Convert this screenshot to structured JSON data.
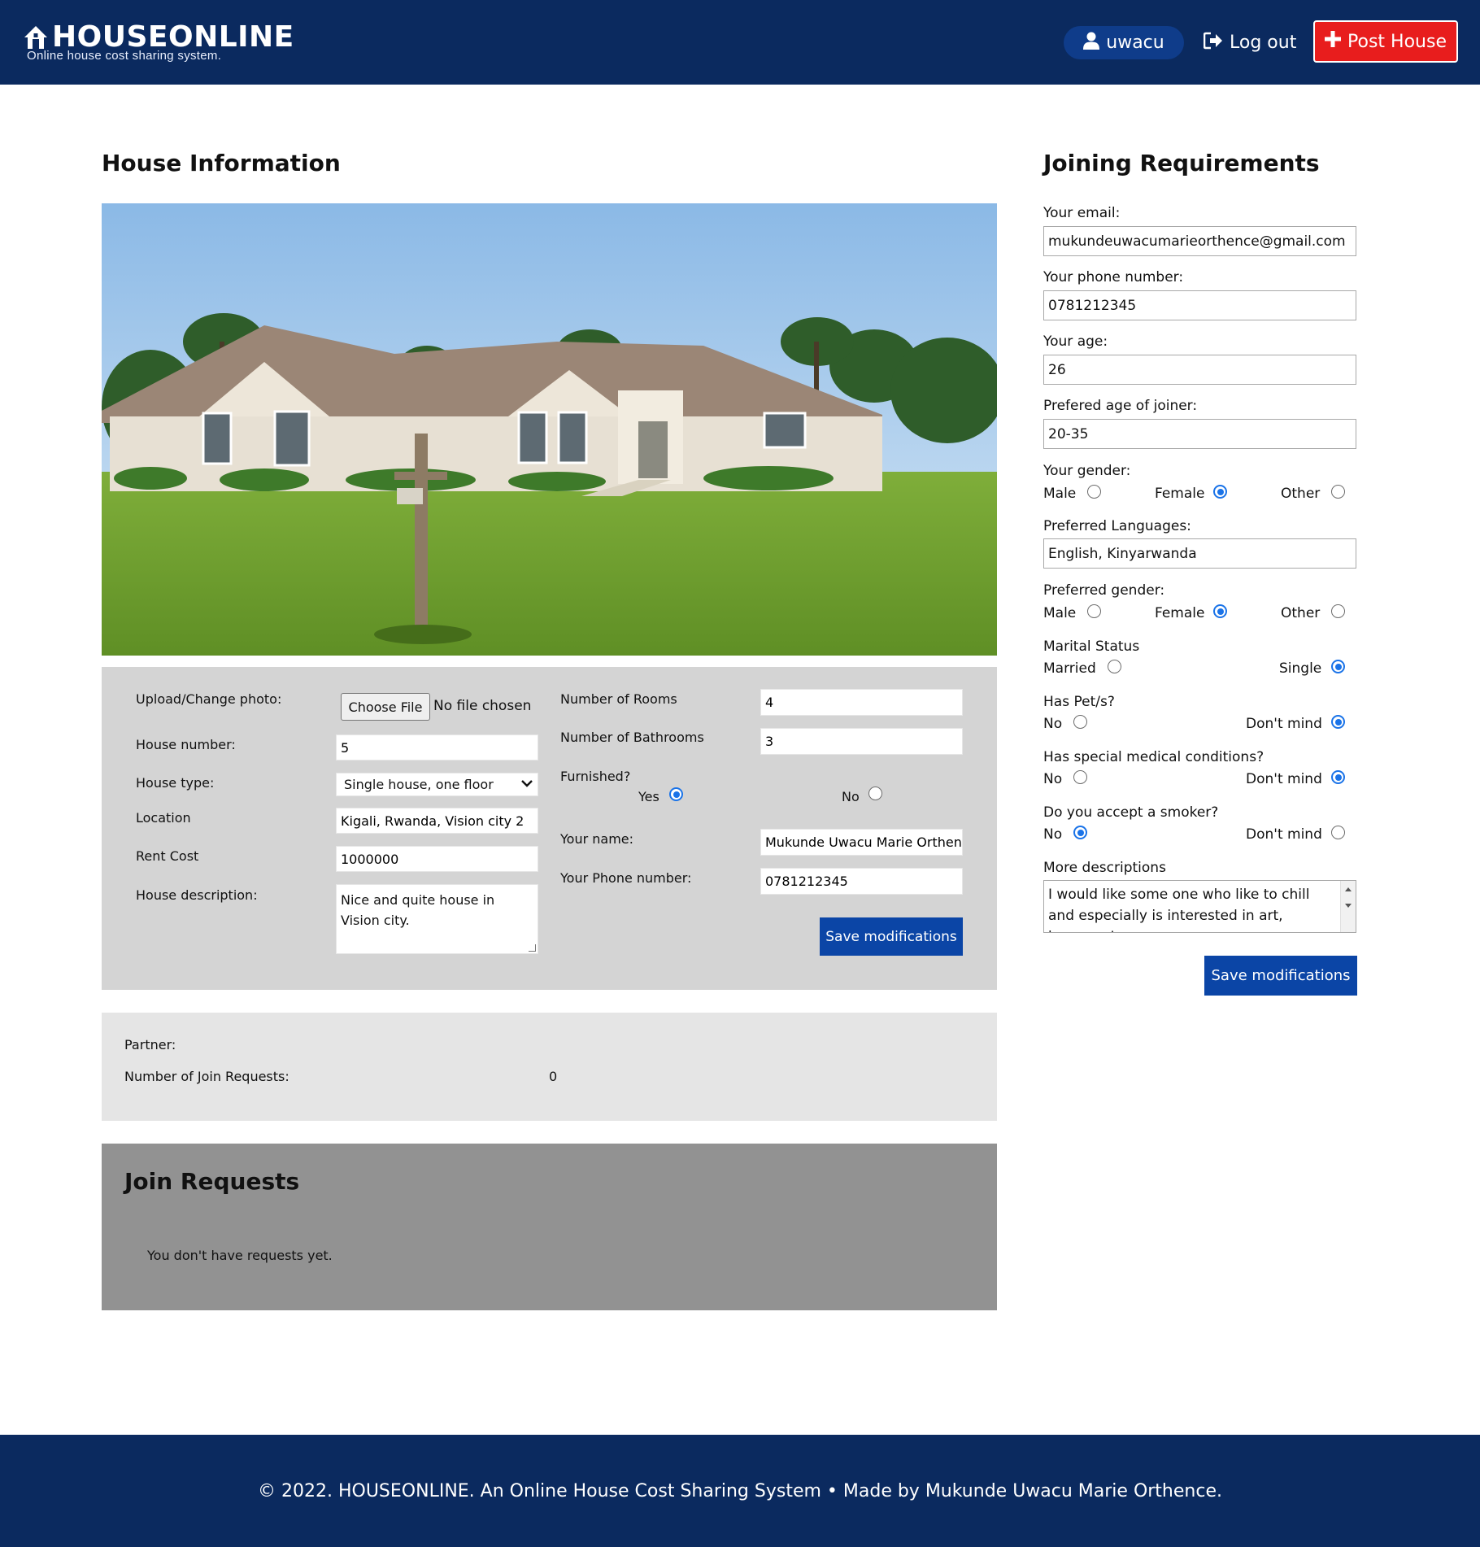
{
  "header": {
    "brand": "HOUSEONLINE",
    "tagline": "Online house cost sharing system.",
    "username": "uwacu",
    "logout_label": "Log out",
    "post_label": "Post House"
  },
  "house_section": {
    "title": "House Information",
    "photo_icon": "house-photo",
    "upload_label": "Upload/Change photo:",
    "choose_file_label": "Choose File",
    "file_status": "No file chosen",
    "house_number_label": "House number:",
    "house_number": "5",
    "house_type_label": "House type:",
    "house_type": "Single house, one floor",
    "location_label": "Location",
    "location": "Kigali, Rwanda, Vision city 2",
    "rent_label": "Rent Cost",
    "rent": "1000000",
    "description_label": "House description:",
    "description": "Nice and quite house in Vision city.",
    "rooms_label": "Number of Rooms",
    "rooms": "4",
    "bathrooms_label": "Number of Bathrooms",
    "bathrooms": "3",
    "furnished_label": "Furnished?",
    "furnished_yes": "Yes",
    "furnished_no": "No",
    "furnished_value": "Yes",
    "your_name_label": "Your name:",
    "your_name": "Mukunde Uwacu Marie Orthenc",
    "your_phone_label": "Your Phone number:",
    "your_phone": "0781212345",
    "save_label": "Save modifications"
  },
  "partner_panel": {
    "partner_label": "Partner:",
    "partner_value": "",
    "join_count_label": "Number of Join Requests:",
    "join_count": "0"
  },
  "requests_panel": {
    "title": "Join Requests",
    "empty_text": "You don't have requests yet."
  },
  "join_section": {
    "title": "Joining Requirements",
    "email_label": "Your email:",
    "email": "mukundeuwacumarieorthence@gmail.com",
    "phone_label": "Your phone number:",
    "phone": "0781212345",
    "age_label": "Your age:",
    "age": "26",
    "pref_age_label": "Prefered age of joiner:",
    "pref_age": "20-35",
    "gender_label": "Your gender:",
    "gender_options": [
      "Male",
      "Female",
      "Other"
    ],
    "gender_value": "Female",
    "languages_label": "Preferred Languages:",
    "languages": "English, Kinyarwanda",
    "pref_gender_label": "Preferred gender:",
    "pref_gender_options": [
      "Male",
      "Female",
      "Other"
    ],
    "pref_gender_value": "Female",
    "marital_label": "Marital Status",
    "marital_options": [
      "Married",
      "Single"
    ],
    "marital_value": "Single",
    "pets_label": "Has Pet/s?",
    "pets_options": [
      "No",
      "Don't mind"
    ],
    "pets_value": "Don't mind",
    "medical_label": "Has special medical conditions?",
    "medical_options": [
      "No",
      "Don't mind"
    ],
    "medical_value": "Don't mind",
    "smoker_label": "Do you accept a smoker?",
    "smoker_options": [
      "No",
      "Don't mind"
    ],
    "smoker_value": "No",
    "more_label": "More descriptions",
    "more": "I would like some one who like to chill and especially is interested in art, because I am",
    "save_label": "Save modifications"
  },
  "footer": {
    "text": "© 2022. HOUSEONLINE. An Online House Cost Sharing System • Made by Mukunde Uwacu Marie Orthence."
  },
  "colors": {
    "navbar": "#0b2a5f",
    "post_button": "#e81d1d",
    "save_button": "#0b45a6",
    "radio_selected": "#1a73e8"
  }
}
